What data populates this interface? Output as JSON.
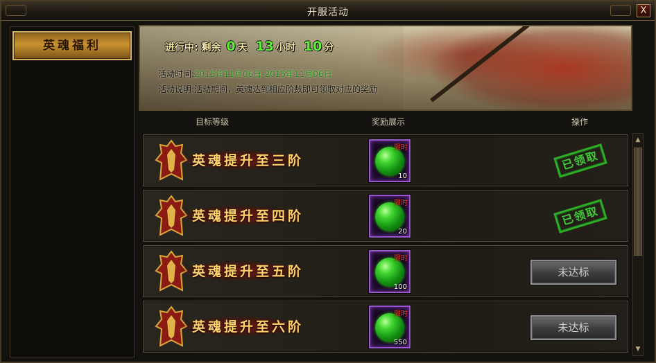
{
  "window": {
    "title": "开服活动",
    "close_label": "X"
  },
  "sidebar": {
    "items": [
      {
        "label": "英魂福利",
        "active": true
      }
    ]
  },
  "banner": {
    "status_prefix": "进行中:",
    "remaining_label": "剩余",
    "days": "0",
    "days_unit": "天",
    "hours": "13",
    "hours_unit": "小时",
    "minutes": "10",
    "minutes_unit": "分",
    "time_label": "活动时间:",
    "time_value": "2015年11月06日-2015年11月06日",
    "desc_label": "活动说明:",
    "desc_value": "活动期间，英魂达到相应阶数即可领取对应的奖励"
  },
  "columns": {
    "level": "目标等级",
    "reward": "奖励展示",
    "operation": "操作"
  },
  "rows": [
    {
      "title": "英魂提升至三阶",
      "limited_tag": "限时",
      "count": "10",
      "status": "已领取",
      "state": "claimed"
    },
    {
      "title": "英魂提升至四阶",
      "limited_tag": "限时",
      "count": "20",
      "status": "已领取",
      "state": "claimed"
    },
    {
      "title": "英魂提升至五阶",
      "limited_tag": "限时",
      "count": "100",
      "status": "未达标",
      "state": "pending"
    },
    {
      "title": "英魂提升至六阶",
      "limited_tag": "限时",
      "count": "550",
      "status": "未达标",
      "state": "pending"
    }
  ],
  "icons": {
    "emblem": "armor-emblem-icon",
    "reward": "green-orb-icon",
    "scroll_up": "arrow-up-icon",
    "scroll_down": "arrow-down-icon"
  },
  "colors": {
    "accent_gold": "#c9922f",
    "countdown_green": "#5ff03a",
    "claimed_green": "#2fb82a",
    "limited_red": "#ff3a2a"
  }
}
